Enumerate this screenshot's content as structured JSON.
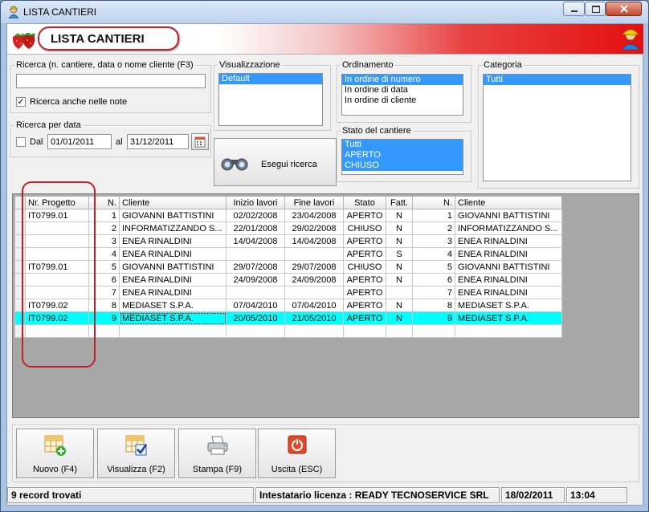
{
  "window": {
    "title": "LISTA CANTIERI"
  },
  "header": {
    "title": "LISTA CANTIERI"
  },
  "search": {
    "legend": "Ricerca (n. cantiere, data o nome cliente (F3)",
    "value": "",
    "notes_label": "Ricerca anche nelle note",
    "notes_checked": true
  },
  "date_search": {
    "legend": "Ricerca per data",
    "dal_label": "Dal",
    "from": "01/01/2011",
    "al_label": "al",
    "to": "31/12/2011",
    "checked": false
  },
  "view": {
    "legend": "Visualizzazione",
    "options": [
      "Default"
    ]
  },
  "ordering": {
    "legend": "Ordinamento",
    "options": [
      "In ordine di numero",
      "In ordine di data",
      "In ordine di cliente"
    ]
  },
  "category": {
    "legend": "Categoria",
    "options": [
      "Tutti"
    ]
  },
  "state": {
    "legend": "Stato del cantiere",
    "options": [
      "Tutti",
      "APERTO",
      "CHIUSO"
    ]
  },
  "search_button": {
    "label": "Esegui ricerca"
  },
  "table": {
    "columns": [
      "Nr. Progetto",
      "N.",
      "Cliente",
      "Inizio lavori",
      "Fine lavori",
      "Stato",
      "Fatt.",
      "N.",
      "Cliente"
    ],
    "rows": [
      [
        "IT0799.01",
        "1",
        "GIOVANNI BATTISTINI",
        "02/02/2008",
        "23/04/2008",
        "APERTO",
        "N",
        "1",
        "GIOVANNI BATTISTINI"
      ],
      [
        "",
        "2",
        "INFORMATIZZANDO S...",
        "22/01/2008",
        "29/02/2008",
        "CHIUSO",
        "N",
        "2",
        "INFORMATIZZANDO S..."
      ],
      [
        "",
        "3",
        "ENEA RINALDINI",
        "14/04/2008",
        "14/04/2008",
        "APERTO",
        "N",
        "3",
        "ENEA RINALDINI"
      ],
      [
        "",
        "4",
        "ENEA RINALDINI",
        "",
        "",
        "APERTO",
        "S",
        "4",
        "ENEA RINALDINI"
      ],
      [
        "IT0799.01",
        "5",
        "GIOVANNI BATTISTINI",
        "29/07/2008",
        "29/07/2008",
        "CHIUSO",
        "N",
        "5",
        "GIOVANNI BATTISTINI"
      ],
      [
        "",
        "6",
        "ENEA RINALDINI",
        "24/09/2008",
        "24/09/2008",
        "APERTO",
        "N",
        "6",
        "ENEA RINALDINI"
      ],
      [
        "",
        "7",
        "ENEA RINALDINI",
        "",
        "",
        "APERTO",
        "",
        "7",
        "ENEA RINALDINI"
      ],
      [
        "IT0799.02",
        "8",
        "MEDIASET S.P.A.",
        "07/04/2010",
        "07/04/2010",
        "APERTO",
        "N",
        "8",
        "MEDIASET S.P.A."
      ],
      [
        "IT0799.02",
        "9",
        "MEDIASET S.P.A.",
        "20/05/2010",
        "21/05/2010",
        "APERTO",
        "N",
        "9",
        "MEDIASET S.P.A."
      ]
    ]
  },
  "toolbar": {
    "new": "Nuovo (F4)",
    "view": "Visualizza (F2)",
    "print": "Stampa (F9)",
    "exit": "Uscita (ESC)"
  },
  "status": {
    "records": "9 record trovati",
    "license": "Intestatario licenza : READY TECNOSERVICE SRL",
    "date": "18/02/2011",
    "time": "13:04"
  }
}
